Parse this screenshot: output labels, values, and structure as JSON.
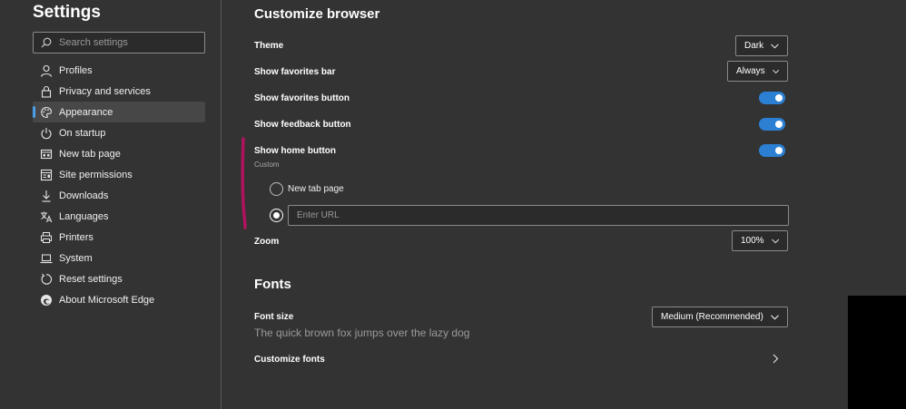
{
  "sidebar": {
    "title": "Settings",
    "search_placeholder": "Search settings",
    "items": [
      {
        "label": "Profiles",
        "icon": "profile-icon"
      },
      {
        "label": "Privacy and services",
        "icon": "lock-icon"
      },
      {
        "label": "Appearance",
        "icon": "palette-icon",
        "active": true
      },
      {
        "label": "On startup",
        "icon": "power-icon"
      },
      {
        "label": "New tab page",
        "icon": "new-tab-icon"
      },
      {
        "label": "Site permissions",
        "icon": "site-permissions-icon"
      },
      {
        "label": "Downloads",
        "icon": "download-icon"
      },
      {
        "label": "Languages",
        "icon": "languages-icon"
      },
      {
        "label": "Printers",
        "icon": "printer-icon"
      },
      {
        "label": "System",
        "icon": "laptop-icon"
      },
      {
        "label": "Reset settings",
        "icon": "reset-icon"
      },
      {
        "label": "About Microsoft Edge",
        "icon": "edge-logo-icon"
      }
    ]
  },
  "customize": {
    "title": "Customize browser",
    "theme": {
      "label": "Theme",
      "value": "Dark"
    },
    "favorites_bar": {
      "label": "Show favorites bar",
      "value": "Always"
    },
    "favorites_button": {
      "label": "Show favorites button",
      "on": true
    },
    "feedback_button": {
      "label": "Show feedback button",
      "on": true
    },
    "home_button": {
      "label": "Show home button",
      "on": true,
      "sub_label": "Custom"
    },
    "home_options": {
      "new_tab_label": "New tab page",
      "url_placeholder": "Enter URL",
      "selected": "url"
    },
    "zoom": {
      "label": "Zoom",
      "value": "100%"
    }
  },
  "fonts": {
    "title": "Fonts",
    "font_size": {
      "label": "Font size",
      "value": "Medium (Recommended)"
    },
    "sample_text": "The quick brown fox jumps over the lazy dog",
    "customize_label": "Customize fonts"
  },
  "colors": {
    "background": "#333333",
    "accent": "#2b80d4",
    "annotation": "#b0135e"
  }
}
